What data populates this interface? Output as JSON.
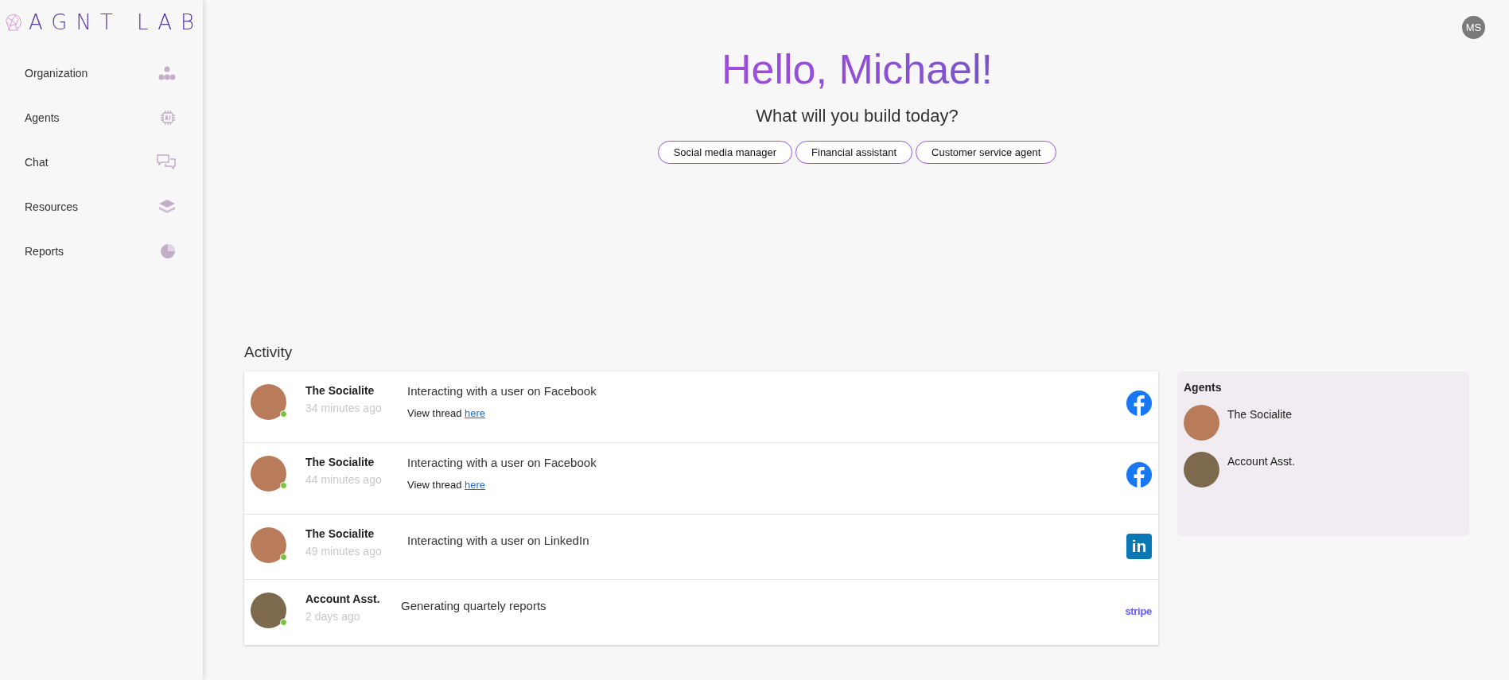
{
  "brand": {
    "name": "AGNT LAB"
  },
  "sidebar": {
    "items": [
      {
        "label": "Organization",
        "kind": "org"
      },
      {
        "label": "Agents",
        "kind": "chip"
      },
      {
        "label": "Chat",
        "kind": "chat"
      },
      {
        "label": "Resources",
        "kind": "layers"
      },
      {
        "label": "Reports",
        "kind": "pie"
      }
    ]
  },
  "user": {
    "initials": "MS"
  },
  "hero": {
    "greeting": "Hello, Michael!",
    "subtitle": "What will you build today?",
    "suggestions": [
      "Social media manager",
      "Financial assistant",
      "Customer service agent"
    ]
  },
  "activity": {
    "title": "Activity",
    "rows": [
      {
        "agent": "The Socialite",
        "time": "34 minutes ago",
        "online": true,
        "message": "Interacting with a user on Facebook",
        "thread_prefix": "View thread",
        "thread_link": "here",
        "platform": {
          "kind": "facebook"
        }
      },
      {
        "agent": "The Socialite",
        "time": "44 minutes ago",
        "online": true,
        "message": "Interacting with a user on Facebook",
        "thread_prefix": "View thread",
        "thread_link": "here",
        "platform": {
          "kind": "facebook"
        }
      },
      {
        "agent": "The Socialite",
        "time": "49 minutes ago",
        "online": true,
        "message": "Interacting with a user on LinkedIn",
        "platform": {
          "kind": "linkedin",
          "label": "in"
        }
      },
      {
        "agent": "Account Asst.",
        "time": "2 days ago",
        "online": true,
        "message": "Generating quartely reports",
        "platform": {
          "kind": "stripe",
          "label": "stripe"
        }
      }
    ]
  },
  "agents_panel": {
    "title": "Agents",
    "agents": [
      "The Socialite",
      "Account Asst."
    ]
  }
}
